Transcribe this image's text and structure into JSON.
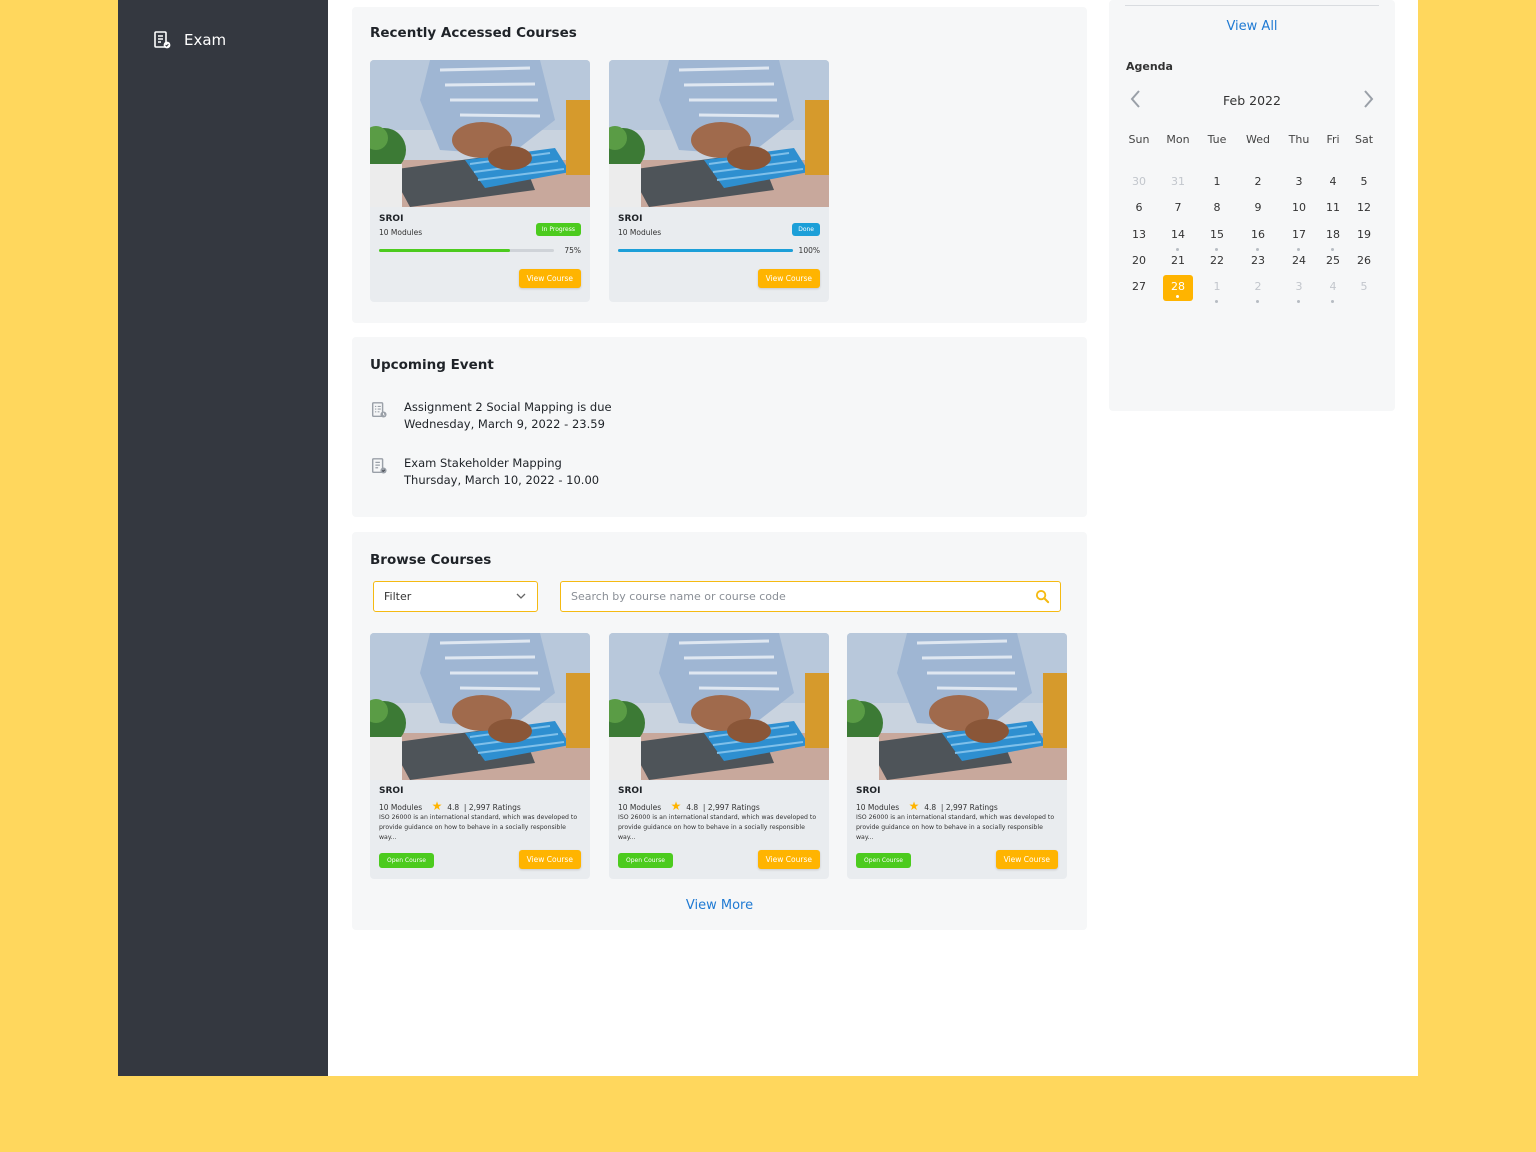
{
  "sidebar": {
    "items": [
      {
        "label": "Exam",
        "icon": "exam-icon"
      }
    ]
  },
  "recent": {
    "title": "Recently Accessed Courses",
    "courses": [
      {
        "name": "SROI",
        "modules": "10 Modules",
        "status": "In Progress",
        "status_color": "#4CCB1E",
        "progress_label": "75%",
        "progress": 0.75,
        "bar_color": "#4CCB1E",
        "button": "View Course"
      },
      {
        "name": "SROI",
        "modules": "10 Modules",
        "status": "Done",
        "status_color": "#1C9FD8",
        "progress_label": "100%",
        "progress": 1.0,
        "bar_color": "#1C9FD8",
        "button": "View Course"
      }
    ]
  },
  "events": {
    "title": "Upcoming Event",
    "items": [
      {
        "icon": "assignment-icon",
        "title": "Assignment 2 Social Mapping is due",
        "date": "Wednesday, March 9, 2022 - 23.59"
      },
      {
        "icon": "exam-icon",
        "title": "Exam Stakeholder Mapping",
        "date": "Thursday, March 10, 2022 - 10.00"
      }
    ]
  },
  "browse": {
    "title": "Browse Courses",
    "filter_label": "Filter",
    "search_placeholder": "Search by course name or course code",
    "courses": [
      {
        "name": "SROI",
        "modules": "10 Modules",
        "rating": "4.8",
        "ratings_count": "2,997 Ratings",
        "description": "ISO 26000 is an international standard, which was developed to provide guidance on how to behave in a socially responsible way...",
        "open_button": "Open Course",
        "view_button": "View Course"
      },
      {
        "name": "SROI",
        "modules": "10 Modules",
        "rating": "4.8",
        "ratings_count": "2,997 Ratings",
        "description": "ISO 26000 is an international standard, which was developed to provide guidance on how to behave in a socially responsible way...",
        "open_button": "Open Course",
        "view_button": "View Course"
      },
      {
        "name": "SROI",
        "modules": "10 Modules",
        "rating": "4.8",
        "ratings_count": "2,997 Ratings",
        "description": "ISO 26000 is an international standard, which was developed to provide guidance on how to behave in a socially responsible way...",
        "open_button": "Open Course",
        "view_button": "View Course"
      }
    ],
    "view_more": "View More"
  },
  "agenda": {
    "view_all": "View All",
    "title": "Agenda",
    "month": "Feb 2022",
    "weekdays": [
      "Sun",
      "Mon",
      "Tue",
      "Wed",
      "Thu",
      "Fri",
      "Sat"
    ],
    "weeks": [
      [
        {
          "d": "30",
          "muted": true
        },
        {
          "d": "31",
          "muted": true
        },
        {
          "d": "1"
        },
        {
          "d": "2"
        },
        {
          "d": "3"
        },
        {
          "d": "4"
        },
        {
          "d": "5"
        }
      ],
      [
        {
          "d": "6"
        },
        {
          "d": "7"
        },
        {
          "d": "8"
        },
        {
          "d": "9"
        },
        {
          "d": "10"
        },
        {
          "d": "11"
        },
        {
          "d": "12"
        }
      ],
      [
        {
          "d": "13"
        },
        {
          "d": "14",
          "dot": true
        },
        {
          "d": "15",
          "dot": true
        },
        {
          "d": "16",
          "dot": true
        },
        {
          "d": "17",
          "dot": true
        },
        {
          "d": "18",
          "dot": true
        },
        {
          "d": "19"
        }
      ],
      [
        {
          "d": "20"
        },
        {
          "d": "21"
        },
        {
          "d": "22"
        },
        {
          "d": "23"
        },
        {
          "d": "24"
        },
        {
          "d": "25"
        },
        {
          "d": "26"
        }
      ],
      [
        {
          "d": "27"
        },
        {
          "d": "28",
          "today": true,
          "dot": true
        },
        {
          "d": "1",
          "muted": true,
          "dot": true
        },
        {
          "d": "2",
          "muted": true,
          "dot": true
        },
        {
          "d": "3",
          "muted": true,
          "dot": true
        },
        {
          "d": "4",
          "muted": true,
          "dot": true
        },
        {
          "d": "5",
          "muted": true
        }
      ]
    ]
  },
  "colors": {
    "accent": "#FFB400",
    "sidebar": "#343840",
    "link": "#1f7ad3",
    "background": "#FFD75D"
  }
}
